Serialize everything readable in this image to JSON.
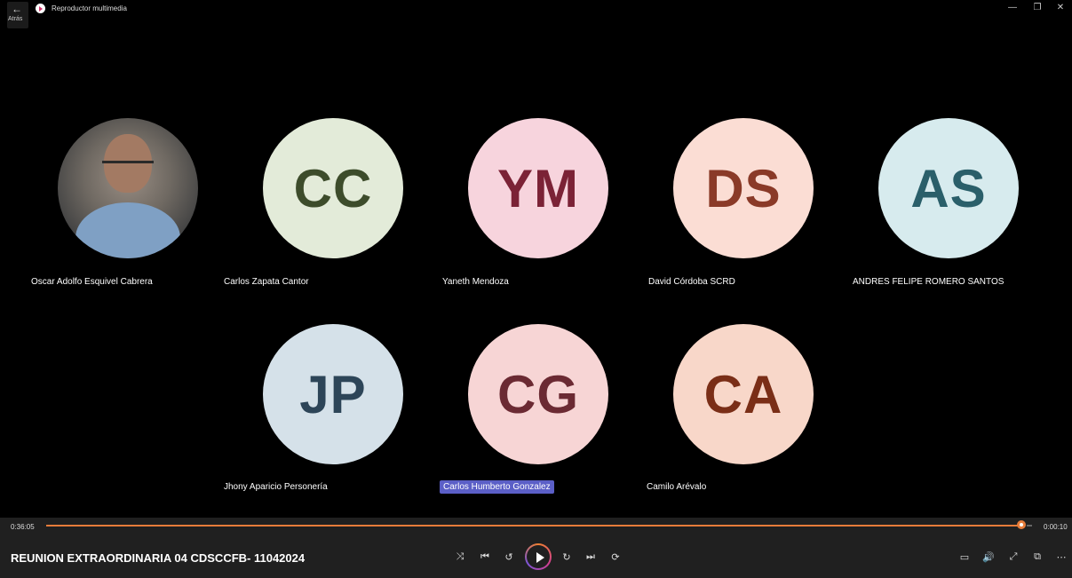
{
  "window": {
    "back_arrow": "←",
    "back_label": "Atrás",
    "app_title": "Reproductor multimedia",
    "minimize": "—",
    "restore": "❐",
    "close": "✕"
  },
  "participants": [
    {
      "initials": "",
      "name": "Oscar Adolfo Esquivel Cabrera",
      "bg": "#555555",
      "fg": "#ffffff"
    },
    {
      "initials": "CC",
      "name": "Carlos Zapata Cantor",
      "bg": "#e3ebd9",
      "fg": "#3d4c2b"
    },
    {
      "initials": "YM",
      "name": "Yaneth Mendoza",
      "bg": "#f7d4dd",
      "fg": "#7b2236"
    },
    {
      "initials": "DS",
      "name": "David Córdoba SCRD",
      "bg": "#fbddd4",
      "fg": "#8a3a28"
    },
    {
      "initials": "AS",
      "name": "ANDRES FELIPE ROMERO SANTOS",
      "bg": "#d7ebee",
      "fg": "#2a5f6a"
    },
    {
      "initials": "JP",
      "name": "Jhony Aparicio Personería",
      "bg": "#d5e1e9",
      "fg": "#2d4558"
    },
    {
      "initials": "CG",
      "name": "Carlos Humberto Gonzalez",
      "bg": "#f7d5d5",
      "fg": "#6b2a33"
    },
    {
      "initials": "CA",
      "name": "Camilo Arévalo",
      "bg": "#f8d7c9",
      "fg": "#7a2e17"
    }
  ],
  "player": {
    "current_time": "0:36:05",
    "remaining_time": "0:00:10",
    "progress": 0.993,
    "title": "REUNION EXTRAORDINARIA 04 CDSCCFB- 11042024",
    "accent": "#e67c3a",
    "icons": {
      "shuffle": "⤨",
      "previous": "⏮",
      "rewind": "↺",
      "forward": "↻",
      "next": "⏭",
      "repeat": "⟳",
      "subtitles": "▭",
      "volume": "🔊",
      "fullscreen": "⤢",
      "miniplayer": "⧉",
      "more": "⋯"
    }
  }
}
